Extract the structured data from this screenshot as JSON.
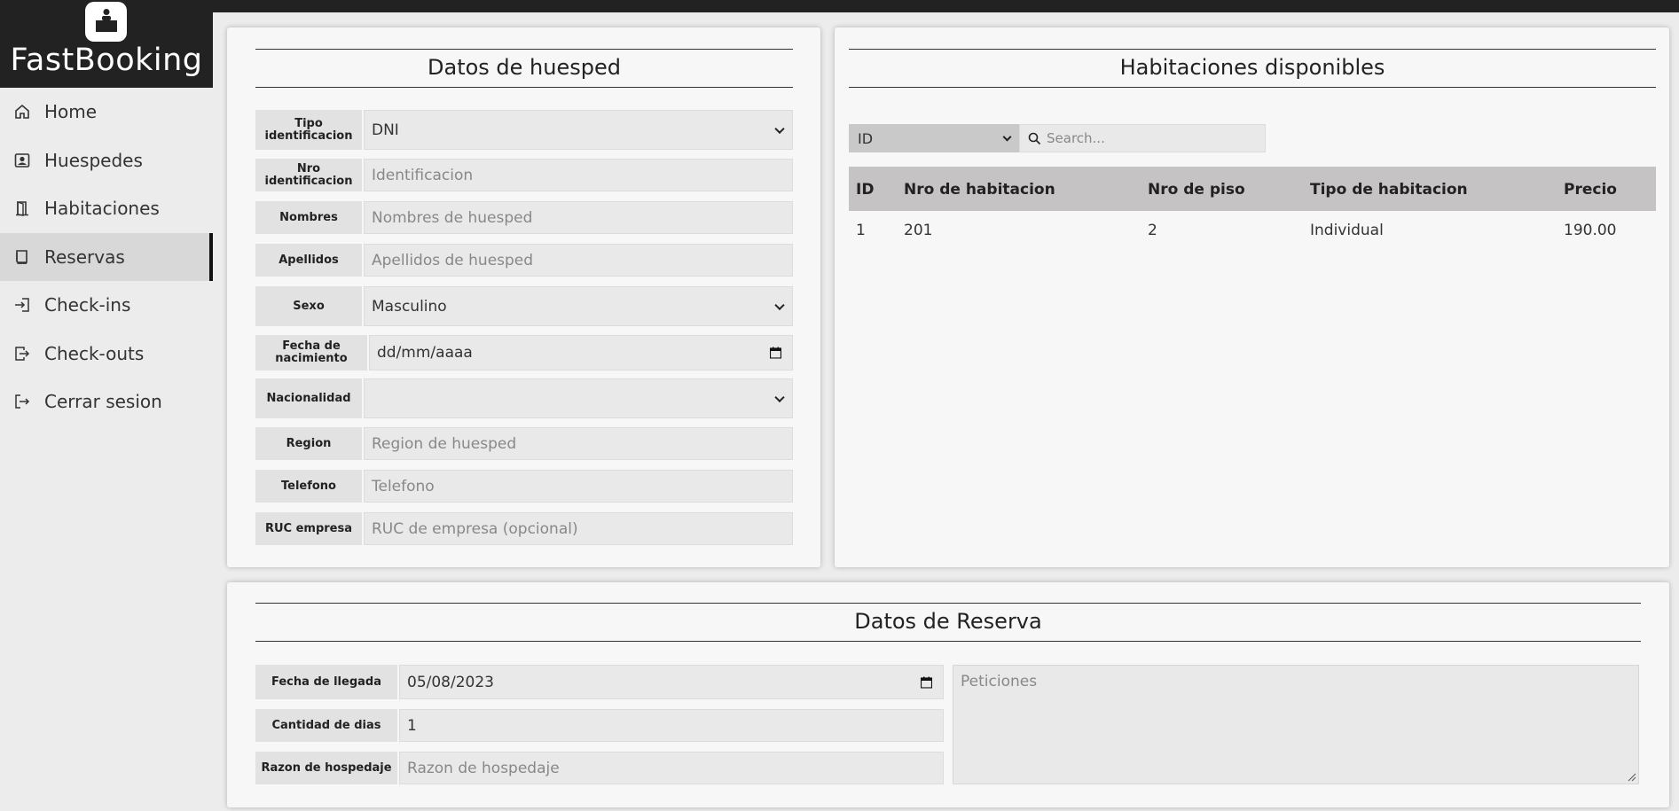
{
  "app": {
    "brand": "FastBooking"
  },
  "sidebar": {
    "items": [
      {
        "label": "Home",
        "icon": "home-icon"
      },
      {
        "label": "Huespedes",
        "icon": "user-card-icon"
      },
      {
        "label": "Habitaciones",
        "icon": "door-icon"
      },
      {
        "label": "Reservas",
        "icon": "book-icon",
        "active": true
      },
      {
        "label": "Check-ins",
        "icon": "login-icon"
      },
      {
        "label": "Check-outs",
        "icon": "logout-icon"
      },
      {
        "label": "Cerrar sesion",
        "icon": "exit-icon"
      }
    ]
  },
  "guest": {
    "title": "Datos de huesped",
    "fields": {
      "tipo_id": {
        "label": "Tipo identificacion",
        "value": "DNI"
      },
      "nro_id": {
        "label": "Nro identificacion",
        "placeholder": "Identificacion"
      },
      "nombres": {
        "label": "Nombres",
        "placeholder": "Nombres de huesped"
      },
      "apellidos": {
        "label": "Apellidos",
        "placeholder": "Apellidos de huesped"
      },
      "sexo": {
        "label": "Sexo",
        "value": "Masculino"
      },
      "fecha_nac": {
        "label": "Fecha de nacimiento",
        "value": "dd/mm/aaaa"
      },
      "nacionalidad": {
        "label": "Nacionalidad",
        "value": ""
      },
      "region": {
        "label": "Region",
        "placeholder": "Region de huesped"
      },
      "telefono": {
        "label": "Telefono",
        "placeholder": "Telefono"
      },
      "ruc": {
        "label": "RUC empresa",
        "placeholder": "RUC de empresa (opcional)"
      }
    }
  },
  "rooms": {
    "title": "Habitaciones disponibles",
    "filter_value": "ID",
    "search_placeholder": "Search...",
    "columns": [
      "ID",
      "Nro de habitacion",
      "Nro de piso",
      "Tipo de habitacion",
      "Precio"
    ],
    "rows": [
      [
        "1",
        "201",
        "2",
        "Individual",
        "190.00"
      ]
    ]
  },
  "reservation": {
    "title": "Datos de Reserva",
    "fields": {
      "llegada": {
        "label": "Fecha de llegada",
        "value": "05/08/2023"
      },
      "dias": {
        "label": "Cantidad de dias",
        "value": "1"
      },
      "razon": {
        "label": "Razon de hospedaje",
        "placeholder": "Razon de hospedaje"
      }
    },
    "peticiones_placeholder": "Peticiones"
  }
}
